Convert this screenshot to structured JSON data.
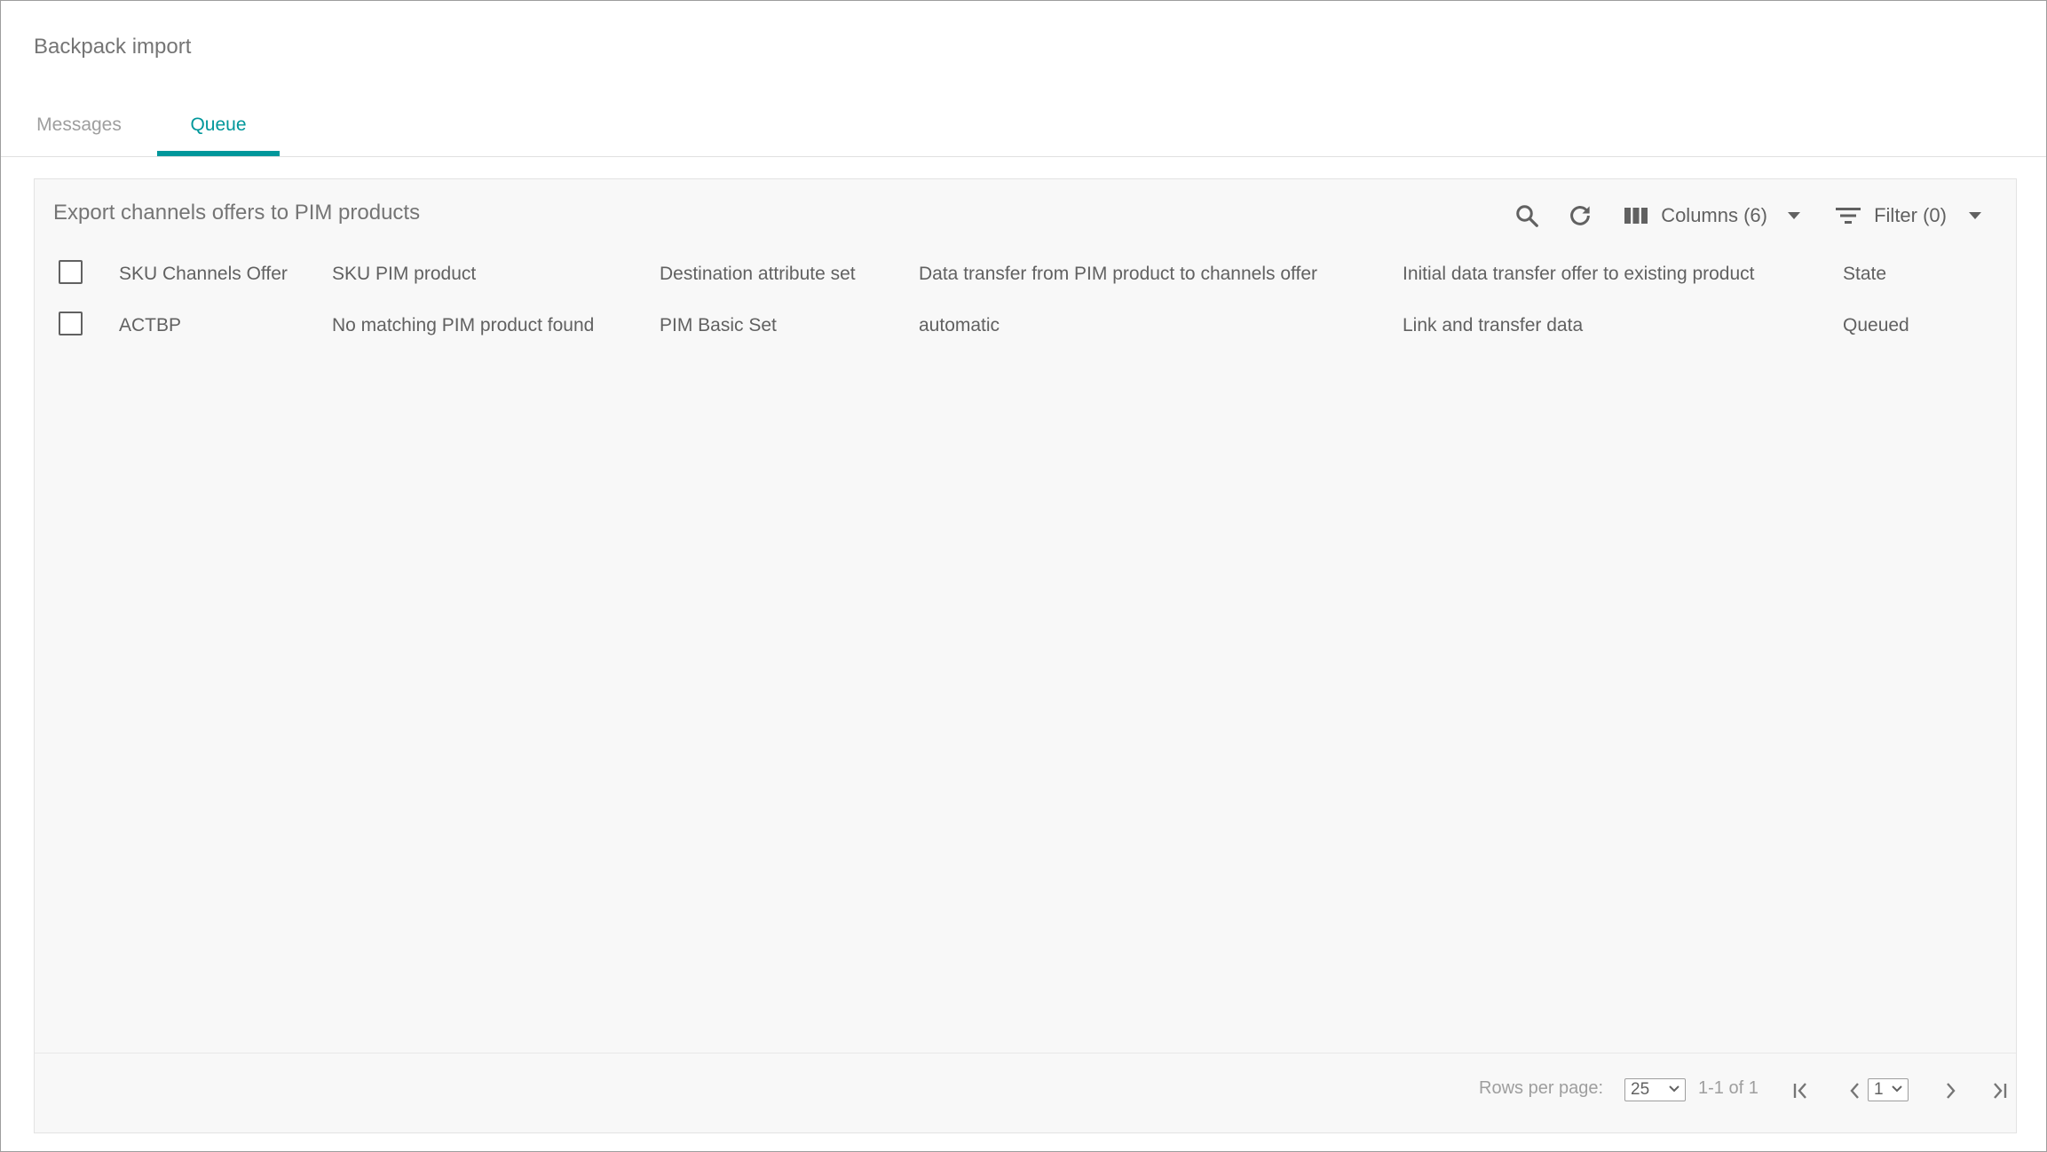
{
  "app": {
    "title": "Backpack import"
  },
  "tabs": [
    {
      "label": "Messages",
      "active": false
    },
    {
      "label": "Queue",
      "active": true
    }
  ],
  "panel": {
    "title": "Export channels offers to PIM products",
    "toolbar": {
      "search_icon": "search-icon",
      "refresh_icon": "refresh-icon",
      "columns_label": "Columns (6)",
      "filter_label": "Filter (0)"
    }
  },
  "table": {
    "headers": [
      "SKU Channels Offer",
      "SKU PIM product",
      "Destination attribute set",
      "Data transfer from PIM product to channels offer",
      "Initial data transfer offer to existing product",
      "State"
    ],
    "rows": [
      [
        "ACTBP",
        "No matching PIM product found",
        "PIM Basic Set",
        "automatic",
        "Link and transfer data",
        "Queued"
      ]
    ]
  },
  "footer": {
    "rows_per_page_label": "Rows per page:",
    "rows_per_page_value": "25",
    "range_text": "1-1 of 1",
    "page_value": "1"
  },
  "colors": {
    "accent": "#00979b",
    "text": "#616161",
    "muted": "#9e9e9e",
    "panel_bg": "#f8f8f8"
  }
}
